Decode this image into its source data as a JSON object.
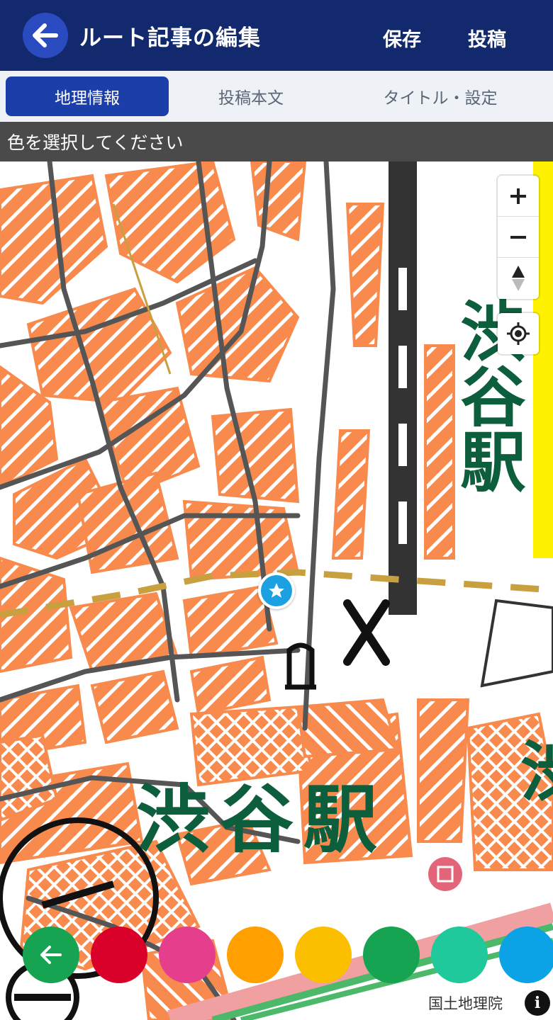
{
  "header": {
    "title": "ルート記事の編集",
    "save_label": "保存",
    "post_label": "投稿"
  },
  "tabs": [
    {
      "label": "地理情報",
      "active": true
    },
    {
      "label": "投稿本文",
      "active": false
    },
    {
      "label": "タイトル・設定",
      "active": false
    }
  ],
  "banner": {
    "text": "色を選択してください"
  },
  "map": {
    "station_label_vertical": "渋谷駅",
    "station_label_horizontal": "渋谷駅",
    "station_label_edge": "渋",
    "attribution": "国土地理院"
  },
  "palette": {
    "colors": [
      "#d9002a",
      "#e43e8d",
      "#ff9f00",
      "#fcbf00",
      "#16a352",
      "#1fc99b",
      "#0ba3e6"
    ],
    "back_color": "#16a352"
  },
  "colors": {
    "header_bg": "#13296e",
    "tab_active": "#1c3ea8",
    "building": "#f98a4d",
    "station_text": "#0d5e3c"
  }
}
